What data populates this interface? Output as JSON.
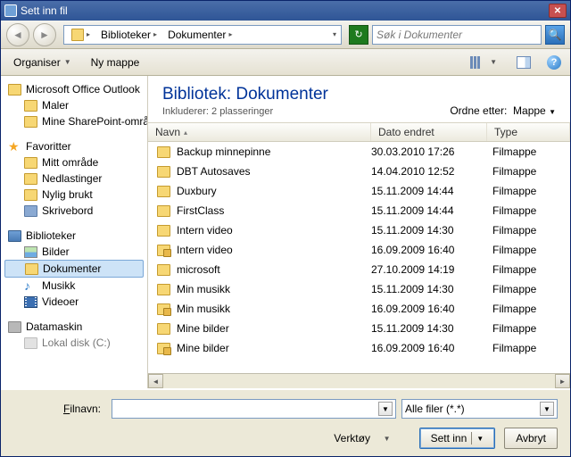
{
  "window": {
    "title": "Sett inn fil"
  },
  "nav": {
    "crumbs": [
      "Biblioteker",
      "Dokumenter"
    ],
    "search_placeholder": "Søk i Dokumenter"
  },
  "toolbar": {
    "organize": "Organiser",
    "newfolder": "Ny mappe"
  },
  "tree": {
    "group1": {
      "head": "Microsoft Office Outlook",
      "items": [
        "Maler",
        "Mine SharePoint-områder"
      ]
    },
    "group2": {
      "head": "Favoritter",
      "items": [
        "Mitt område",
        "Nedlastinger",
        "Nylig brukt",
        "Skrivebord"
      ]
    },
    "group3": {
      "head": "Biblioteker",
      "items": [
        "Bilder",
        "Dokumenter",
        "Musikk",
        "Videoer"
      ]
    },
    "group4": {
      "head": "Datamaskin",
      "items": [
        "Lokal disk (C:)"
      ]
    }
  },
  "content": {
    "heading_prefix": "Bibliotek:",
    "heading_name": "Dokumenter",
    "subline": "Inkluderer:  2 plasseringer",
    "arrange_label": "Ordne etter:",
    "arrange_value": "Mappe",
    "cols": {
      "name": "Navn",
      "date": "Dato endret",
      "type": "Type"
    },
    "rows": [
      {
        "name": "Backup minnepinne",
        "date": "30.03.2010 17:26",
        "type": "Filmappe",
        "lock": false
      },
      {
        "name": "DBT Autosaves",
        "date": "14.04.2010 12:52",
        "type": "Filmappe",
        "lock": false
      },
      {
        "name": "Duxbury",
        "date": "15.11.2009 14:44",
        "type": "Filmappe",
        "lock": false
      },
      {
        "name": "FirstClass",
        "date": "15.11.2009 14:44",
        "type": "Filmappe",
        "lock": false
      },
      {
        "name": "Intern video",
        "date": "15.11.2009 14:30",
        "type": "Filmappe",
        "lock": false
      },
      {
        "name": "Intern video",
        "date": "16.09.2009 16:40",
        "type": "Filmappe",
        "lock": true
      },
      {
        "name": "microsoft",
        "date": "27.10.2009 14:19",
        "type": "Filmappe",
        "lock": false
      },
      {
        "name": "Min musikk",
        "date": "15.11.2009 14:30",
        "type": "Filmappe",
        "lock": false
      },
      {
        "name": "Min musikk",
        "date": "16.09.2009 16:40",
        "type": "Filmappe",
        "lock": true
      },
      {
        "name": "Mine bilder",
        "date": "15.11.2009 14:30",
        "type": "Filmappe",
        "lock": false
      },
      {
        "name": "Mine bilder",
        "date": "16.09.2009 16:40",
        "type": "Filmappe",
        "lock": true
      }
    ]
  },
  "bottom": {
    "filename_label": "Filnavn:",
    "filename_value": "",
    "filter_value": "Alle filer (*.*)",
    "tools": "Verktøy",
    "insert": "Sett inn",
    "cancel": "Avbryt"
  }
}
